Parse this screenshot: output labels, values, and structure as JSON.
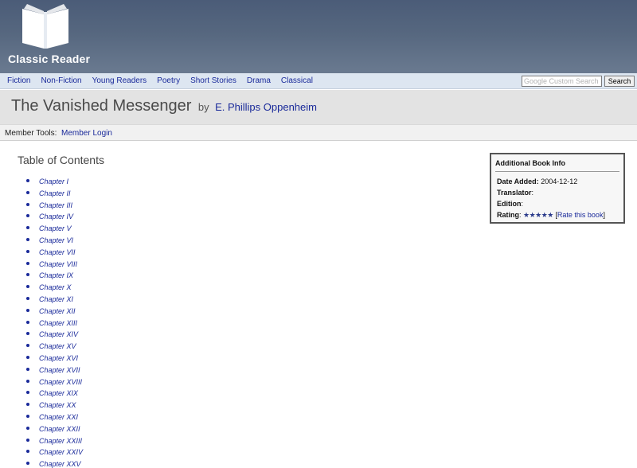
{
  "brand": {
    "name": "Classic Reader",
    "logo_icon": "open-book-icon"
  },
  "nav": {
    "links": [
      "Fiction",
      "Non-Fiction",
      "Young Readers",
      "Poetry",
      "Short Stories",
      "Drama",
      "Classical"
    ],
    "search_placeholder": "Google Custom Search",
    "search_button": "Search"
  },
  "book": {
    "title": "The Vanished Messenger",
    "by": "by",
    "author": "E. Phillips Oppenheim"
  },
  "member": {
    "label": "Member Tools:",
    "login": "Member Login"
  },
  "toc": {
    "heading": "Table of Contents",
    "chapters": [
      "Chapter I",
      "Chapter II",
      "Chapter III",
      "Chapter IV",
      "Chapter V",
      "Chapter VI",
      "Chapter VII",
      "Chapter VIII",
      "Chapter IX",
      "Chapter X",
      "Chapter XI",
      "Chapter XII",
      "Chapter XIII",
      "Chapter XIV",
      "Chapter XV",
      "Chapter XVI",
      "Chapter XVII",
      "Chapter XVIII",
      "Chapter XIX",
      "Chapter XX",
      "Chapter XXI",
      "Chapter XXII",
      "Chapter XXIII",
      "Chapter XXIV",
      "Chapter XXV"
    ]
  },
  "info": {
    "heading": "Additional Book Info",
    "date_label": "Date Added:",
    "date_value": "2004-12-12",
    "translator_label": "Translator",
    "translator_value": ":",
    "edition_label": "Edition",
    "edition_value": ":",
    "rating_label": "Rating",
    "rating_sep": ":",
    "rating_stars": "★★★★★",
    "rate_open": "[",
    "rate_link": "Rate this book",
    "rate_close": "]"
  },
  "colors": {
    "header": "#56677f",
    "nav_bg": "#dde6f1",
    "link": "#1a2a9a",
    "title_bg": "#e3e3e3"
  }
}
